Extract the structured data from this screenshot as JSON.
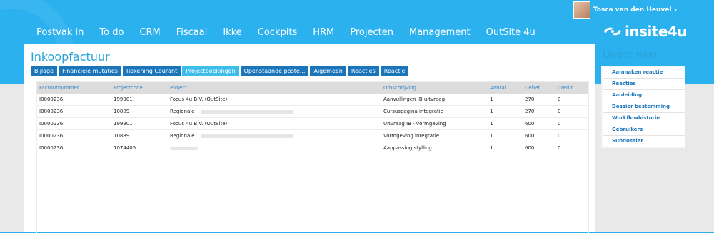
{
  "user": {
    "name": "Tosca van den Heuvel",
    "caret": "▾"
  },
  "nav": [
    "Postvak in",
    "To do",
    "CRM",
    "Fiscaal",
    "Ikke",
    "Cockpits",
    "HRM",
    "Projecten",
    "Management",
    "OutSite 4u"
  ],
  "logo": {
    "text": "insite4u",
    "icon": "insite-logo-icon"
  },
  "page": {
    "title": "Inkoopfactuur",
    "tabs": [
      {
        "label": "Bijlage",
        "active": false
      },
      {
        "label": "Financiële mutaties",
        "active": false
      },
      {
        "label": "Rekening Courant",
        "active": false
      },
      {
        "label": "Projectboekingen",
        "active": true
      },
      {
        "label": "Openstaande poste...",
        "active": false
      },
      {
        "label": "Algemeen",
        "active": false
      },
      {
        "label": "Reacties",
        "active": false
      },
      {
        "label": "Reactie",
        "active": false
      }
    ]
  },
  "table": {
    "headers": [
      "Factuurnummer",
      "Projectcode",
      "Project",
      "Omschrijving",
      "Aantal",
      "Debet",
      "Credit"
    ],
    "rows": [
      [
        "I0000236",
        "199901",
        "Focus 4u B.V. (OutSite)",
        "Aanvullingen IB uitvraag",
        "1",
        "270",
        "0"
      ],
      [
        "I0000236",
        "10889",
        "Regionale",
        "Cursuspagina integratie",
        "1",
        "270",
        "0"
      ],
      [
        "I0000236",
        "199901",
        "Focus 4u B.V. (OutSite)",
        "Uitvraag IB - vormgeving",
        "1",
        "600",
        "0"
      ],
      [
        "I0000236",
        "10889",
        "Regionale",
        "Vormgeving integratie",
        "1",
        "600",
        "0"
      ],
      [
        "I0000236",
        "1074405",
        "",
        "Aanpassing stylling",
        "1",
        "600",
        "0"
      ]
    ]
  },
  "sidebar": {
    "title": "Direct naar",
    "items": [
      "Aanmaken reactie",
      "Reacties",
      "Aanleiding",
      "Dossier bestemming",
      "Workflowhistorie",
      "Gebruikers",
      "Subdossier"
    ]
  },
  "colors": {
    "header_bg": "#2bb1ee",
    "accent": "#2aa4db",
    "tab_bg": "#1b75bb",
    "tab_active": "#3dbde9"
  }
}
